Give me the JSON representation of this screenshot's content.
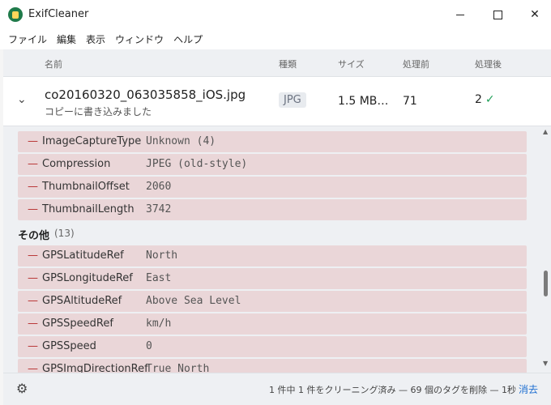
{
  "window": {
    "title": "ExifCleaner",
    "controls": {
      "minimize": "minimize",
      "maximize": "maximize",
      "close": "✕"
    }
  },
  "menu": [
    "ファイル",
    "編集",
    "表示",
    "ウィンドウ",
    "ヘルプ"
  ],
  "columns": {
    "name": "名前",
    "type": "種類",
    "size": "サイズ",
    "before": "処理前",
    "after": "処理後"
  },
  "file": {
    "name": "co20160320_063035858_iOS.jpg",
    "subtitle": "コピーに書き込みました",
    "type": "JPG",
    "size": "1.5 MB…",
    "before": "71",
    "after": "2"
  },
  "tags_top": [
    {
      "key": "ImageCaptureType",
      "value": "Unknown (4)"
    },
    {
      "key": "Compression",
      "value": "JPEG (old-style)"
    },
    {
      "key": "ThumbnailOffset",
      "value": "2060"
    },
    {
      "key": "ThumbnailLength",
      "value": "3742"
    }
  ],
  "section": {
    "title": "その他",
    "count": "(13)"
  },
  "tags_other": [
    {
      "key": "GPSLatitudeRef",
      "value": "North"
    },
    {
      "key": "GPSLongitudeRef",
      "value": "East"
    },
    {
      "key": "GPSAltitudeRef",
      "value": "Above Sea Level"
    },
    {
      "key": "GPSSpeedRef",
      "value": "km/h"
    },
    {
      "key": "GPSSpeed",
      "value": "0"
    },
    {
      "key": "GPSImgDirectionRef",
      "value": "True North"
    }
  ],
  "footer": {
    "status": "1 件中 1 件をクリーニング済み — 69 個のタグを削除 — 1秒",
    "clear": "消去"
  },
  "colors": {
    "tag_row_bg": "#ead6d8",
    "remove_dash": "#b83232",
    "success_check": "#22a05a",
    "link": "#1f6fd1"
  },
  "icons": {
    "settings": "gear-icon",
    "expand": "chevron-down-icon",
    "success": "check-icon"
  }
}
